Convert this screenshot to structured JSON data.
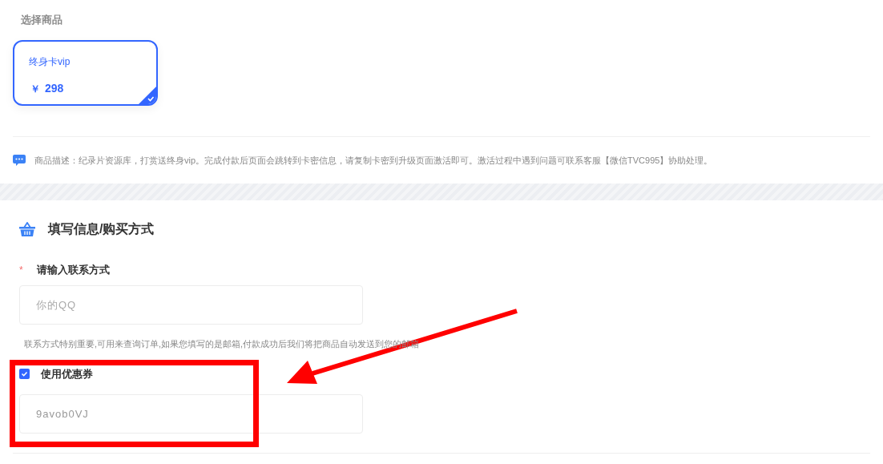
{
  "product_section": {
    "title": "选择商品",
    "products": [
      {
        "name": "终身卡vip",
        "currency": "￥",
        "price": "298",
        "selected": true
      }
    ],
    "description": "商品描述：纪录片资源库，打赏送终身vip。完成付款后页面会跳转到卡密信息，请复制卡密到升级页面激活即可。激活过程中遇到问题可联系客服【微信TVC995】协助处理。"
  },
  "form_section": {
    "title": "填写信息/购买方式",
    "contact": {
      "required_mark": "*",
      "label": "请输入联系方式",
      "placeholder": "你的QQ",
      "hint": "联系方式特别重要,可用来查询订单,如果您填写的是邮箱,付款成功后我们将把商品自动发送到您的邮箱"
    },
    "coupon": {
      "label": "使用优惠券",
      "checked": true,
      "value": "9avob0VJ"
    }
  }
}
